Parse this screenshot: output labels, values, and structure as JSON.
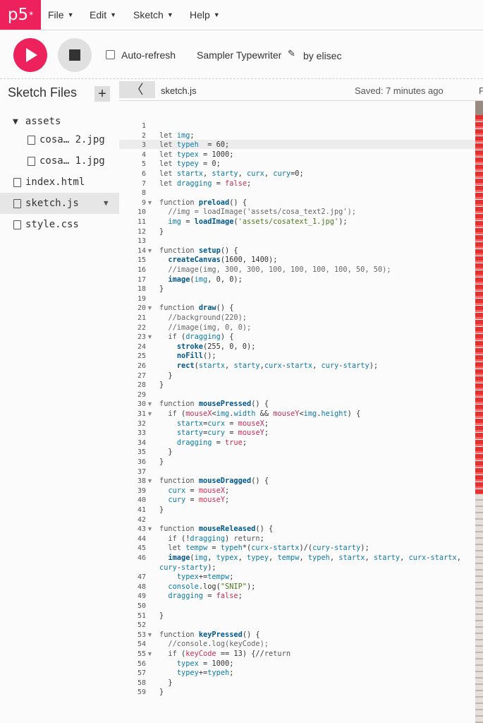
{
  "nav": {
    "logo": "p5",
    "logo_sup": "*",
    "menus": [
      "File",
      "Edit",
      "Sketch",
      "Help"
    ]
  },
  "toolbar": {
    "auto_refresh_label": "Auto-refresh",
    "sketch_name": "Sampler Typewriter",
    "author": "by elisec"
  },
  "sidebar": {
    "title": "Sketch Files",
    "add": "+",
    "folder": "assets",
    "files": [
      "cosa… 2.jpg",
      "cosa… 1.jpg"
    ],
    "root_files": [
      "index.html",
      "sketch.js",
      "style.css"
    ]
  },
  "editor": {
    "file_name": "sketch.js",
    "saved_status": "Saved: 7 minutes ago",
    "right_cut": "P",
    "lines": [
      "",
      "let img;",
      "let typeh  = 60;",
      "let typex = 1000;",
      "let typey = 0;",
      "let startx, starty, curx, cury=0;",
      "let dragging = false;",
      "",
      "function preload() {",
      "  //img = loadImage('assets/cosa_text2.jpg');",
      "  img = loadImage('assets/cosatext_1.jpg');",
      "}",
      "",
      "function setup() {",
      "  createCanvas(1600, 1400);",
      "  //image(img, 300, 300, 100, 100, 100, 100, 50, 50);",
      "  image(img, 0, 0);",
      "}",
      "",
      "function draw() {",
      "  //background(220);",
      "  //image(img, 0, 0);",
      "  if (dragging) {",
      "    stroke(255, 0, 0);",
      "    noFill();",
      "    rect(startx, starty,curx-startx, cury-starty);",
      "  }",
      "}",
      "",
      "function mousePressed() {",
      "  if (mouseX<img.width && mouseY<img.height) {",
      "    startx=curx = mouseX;",
      "    starty=cury = mouseY;",
      "    dragging = true;",
      "  }",
      "}",
      "",
      "function mouseDragged() {",
      "  curx = mouseX;",
      "  cury = mouseY;",
      "}",
      "",
      "function mouseReleased() {",
      "  if (!dragging) return;",
      "  let tempw = typeh*(curx-startx)/(cury-starty);",
      "  image(img, typex, typey, tempw, typeh, startx, starty, curx-startx,",
      "    typex+=tempw;",
      "  console.log(\"SNIP\");",
      "  dragging = false;",
      "",
      "}",
      "",
      "function keyPressed() {",
      "  //console.log(keyCode);",
      "  if (keyCode == 13) {//return",
      "    typex = 1000;",
      "    typey+=typeh;",
      "  }",
      "}"
    ],
    "wrap_line_46": "cury-starty);"
  }
}
